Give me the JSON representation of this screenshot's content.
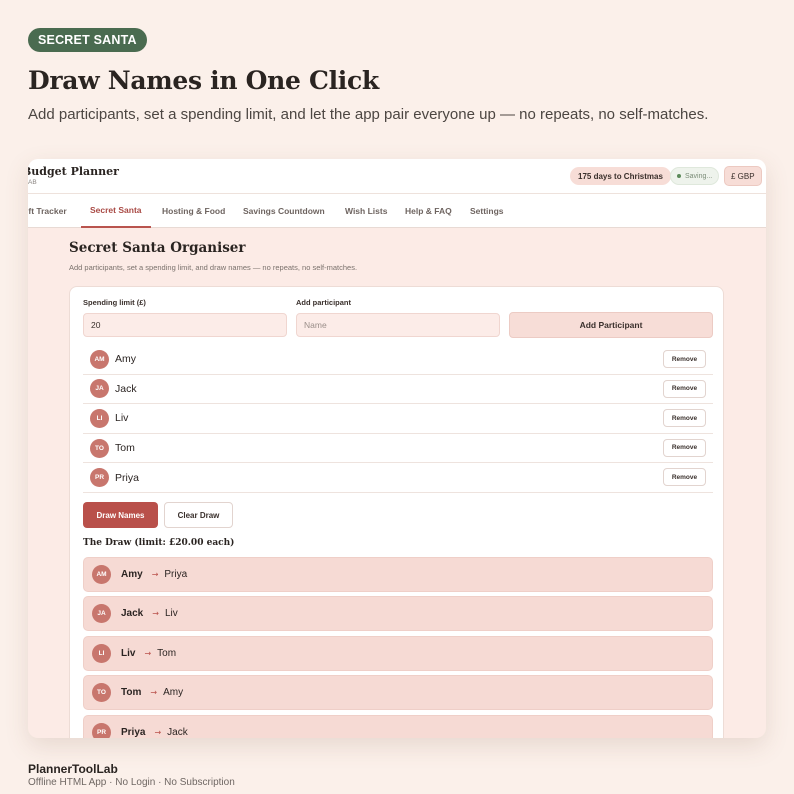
{
  "badge": "SECRET SANTA",
  "hero": {
    "title": "Draw Names in One Click",
    "subtitle": "Add participants, set a spending limit, and let the app pair everyone up — no repeats, no self-matches."
  },
  "app": {
    "name": "Budget Planner",
    "sub": "AB",
    "days_pill": "175 days to Christmas",
    "saving_pill": "Saving...",
    "currency": "£ GBP"
  },
  "tabs": [
    {
      "label": "ift Tracker",
      "active": false
    },
    {
      "label": "Secret Santa",
      "active": true
    },
    {
      "label": "Hosting & Food",
      "active": false
    },
    {
      "label": "Savings Countdown",
      "active": false
    },
    {
      "label": "Wish Lists",
      "active": false
    },
    {
      "label": "Help & FAQ",
      "active": false
    },
    {
      "label": "Settings",
      "active": false
    }
  ],
  "section": {
    "title": "Secret Santa Organiser",
    "subtitle": "Add participants, set a spending limit, and draw names — no repeats, no self-matches."
  },
  "form": {
    "limit_label": "Spending limit (£)",
    "limit_value": "20",
    "add_label": "Add participant",
    "name_placeholder": "Name",
    "add_button": "Add Participant"
  },
  "participants": [
    {
      "initials": "AM",
      "name": "Amy",
      "remove": "Remove"
    },
    {
      "initials": "JA",
      "name": "Jack",
      "remove": "Remove"
    },
    {
      "initials": "LI",
      "name": "Liv",
      "remove": "Remove"
    },
    {
      "initials": "TO",
      "name": "Tom",
      "remove": "Remove"
    },
    {
      "initials": "PR",
      "name": "Priya",
      "remove": "Remove"
    }
  ],
  "actions": {
    "draw": "Draw Names",
    "clear": "Clear Draw"
  },
  "draw": {
    "title": "The Draw (limit: £20.00 each)",
    "arrow": "→",
    "pairs": [
      {
        "initials": "AM",
        "giver": "Amy",
        "receiver": "Priya"
      },
      {
        "initials": "JA",
        "giver": "Jack",
        "receiver": "Liv"
      },
      {
        "initials": "LI",
        "giver": "Liv",
        "receiver": "Tom"
      },
      {
        "initials": "TO",
        "giver": "Tom",
        "receiver": "Amy"
      },
      {
        "initials": "PR",
        "giver": "Priya",
        "receiver": "Jack"
      }
    ]
  },
  "footer": {
    "name": "PlannerToolLab",
    "sub": "Offline HTML App · No Login · No Subscription"
  },
  "colors": {
    "background": "#fbf0ea",
    "badge": "#4a6b50",
    "accent": "#b9504a",
    "avatar": "#c8766d",
    "pair_row": "#f6dad4"
  }
}
